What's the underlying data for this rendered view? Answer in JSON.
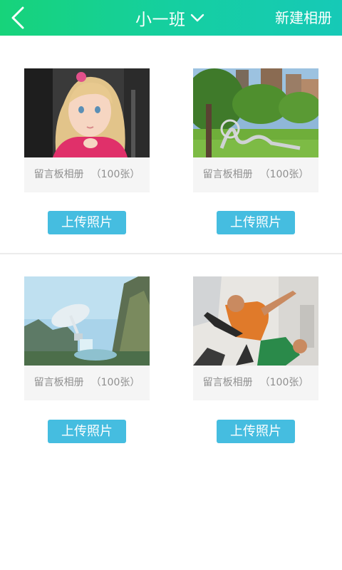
{
  "header": {
    "back_icon": "chevron-left-icon",
    "title": "小一班",
    "dropdown_icon": "chevron-down-icon",
    "new_album_label": "新建相册"
  },
  "albums": [
    {
      "name": "留言板相册",
      "count": "（100张）",
      "upload_label": "上传照片",
      "photo": "girl-portrait"
    },
    {
      "name": "留言板相册",
      "count": "（100张）",
      "upload_label": "上传照片",
      "photo": "park-sculpture"
    },
    {
      "name": "留言板相册",
      "count": "（100张）",
      "upload_label": "上传照片",
      "photo": "fantasy-landscape"
    },
    {
      "name": "留言板相册",
      "count": "（100张）",
      "upload_label": "上传照片",
      "photo": "soccer-player"
    }
  ],
  "colors": {
    "header_start": "#17d37a",
    "header_end": "#16c9b7",
    "upload_button": "#45bde0",
    "caption_bg": "#f5f5f5",
    "caption_text": "#8f8f8f"
  }
}
